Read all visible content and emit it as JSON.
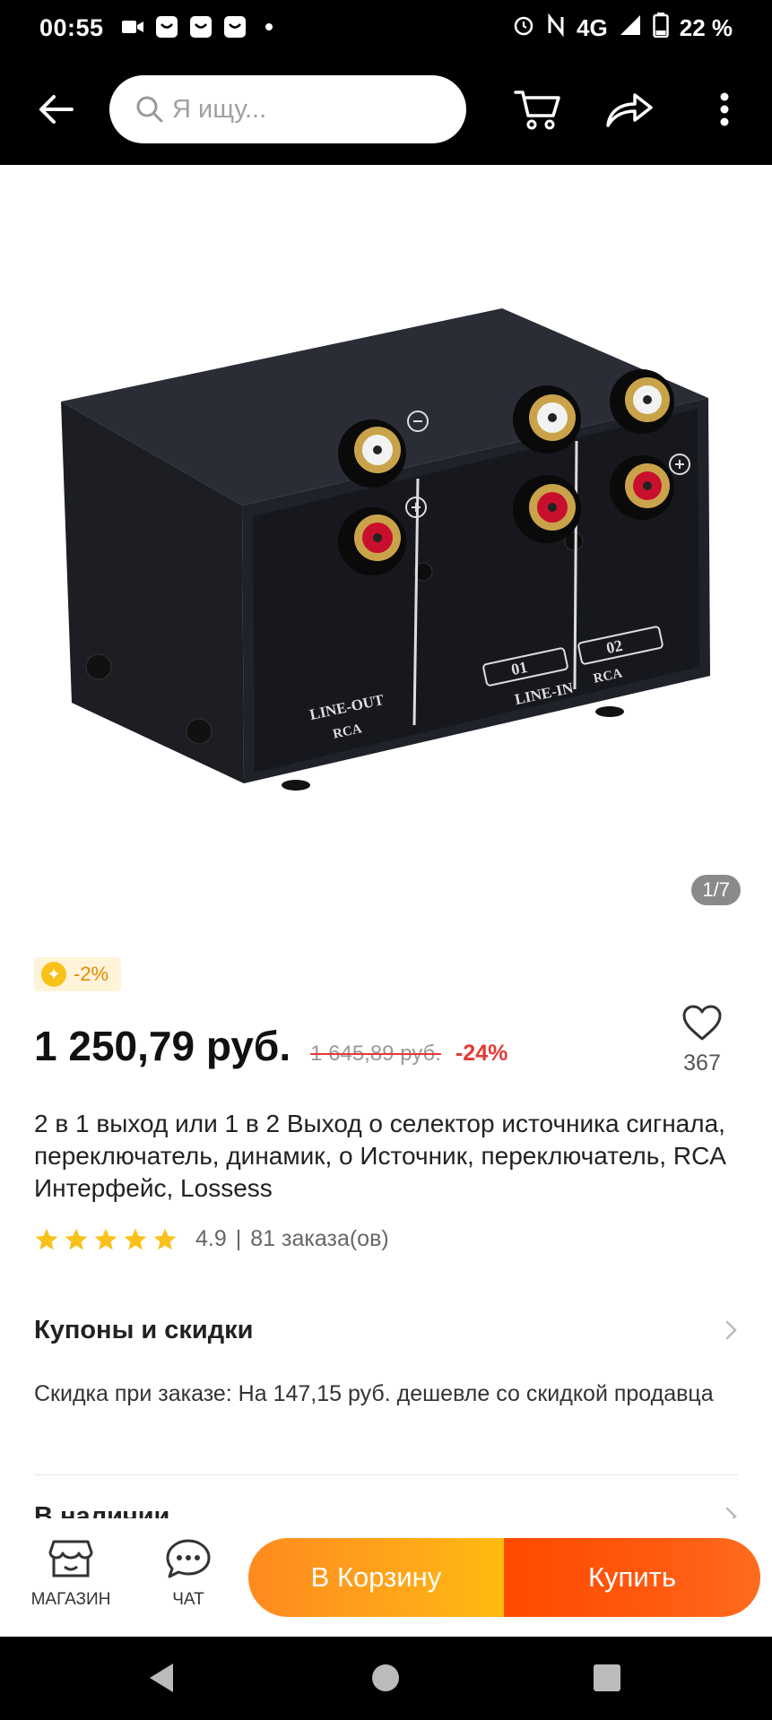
{
  "status_bar": {
    "time": "00:55",
    "network": "4G",
    "battery": "22 %",
    "left_icons": [
      "video-icon",
      "shop-notification-icon",
      "shop-notification-icon",
      "shop-notification-icon",
      "dot-icon"
    ],
    "right_icons": [
      "alarm-icon",
      "nfc-icon",
      "signal-icon",
      "battery-icon"
    ]
  },
  "header": {
    "search_placeholder": "Я ищу...",
    "icons": [
      "back-arrow-icon",
      "search-icon",
      "cart-icon",
      "share-icon",
      "more-vertical-icon"
    ]
  },
  "gallery": {
    "counter": "1/7",
    "image_description_labels": {
      "line_out": "LINE-OUT",
      "rca_left": "RCA",
      "line_in": "LINE-IN",
      "rca_right": "RCA",
      "port1": "01",
      "port2": "02"
    }
  },
  "badge": {
    "text": "-2%"
  },
  "price": {
    "current": "1 250,79 руб.",
    "old": "1 645,89 руб.",
    "discount": "-24%"
  },
  "favorite": {
    "count": "367"
  },
  "product": {
    "title": "2 в 1 выход или 1 в 2 Выход о селектор источника сигнала, переключатель, динамик, о Источник, переключатель, RCA Интерфейс, Lossess",
    "rating": "4.9",
    "rating_separator": "|",
    "orders": "81 заказа(ов)",
    "stars": 5
  },
  "coupons": {
    "heading": "Купоны и скидки",
    "text": "Скидка при заказе: На 147,15 руб. дешевле со скидкой продавца"
  },
  "availability": {
    "heading": "В наличии"
  },
  "bottom_bar": {
    "store_label": "МАГАЗИН",
    "chat_label": "ЧАТ",
    "cart_button": "В Корзину",
    "buy_button": "Купить"
  },
  "colors": {
    "accent_orange": "#ff8a1f",
    "buy_red": "#ff4a00",
    "discount_red": "#e53935",
    "star_yellow": "#f8c21a"
  }
}
